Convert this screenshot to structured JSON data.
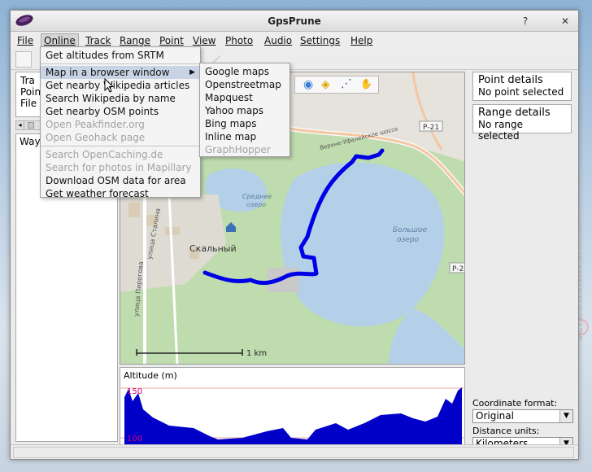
{
  "window": {
    "title": "GpsPrune",
    "buttons": [
      "?",
      "✕"
    ]
  },
  "menubar": {
    "items": [
      "File",
      "Online",
      "Track",
      "Range",
      "Point",
      "View",
      "Photo",
      "Audio",
      "Settings",
      "Help"
    ],
    "active": "Online"
  },
  "online_menu": {
    "items": [
      {
        "label": "Get altitudes from SRTM",
        "enabled": true
      },
      {
        "label": "Map in a browser window",
        "enabled": true,
        "submenu": true
      },
      {
        "label": "Get nearby Wikipedia articles",
        "enabled": true
      },
      {
        "label": "Search Wikipedia by name",
        "enabled": true
      },
      {
        "label": "Get nearby OSM points",
        "enabled": true
      },
      {
        "label": "Open Peakfinder.org",
        "enabled": false
      },
      {
        "label": "Open Geohack page",
        "enabled": false
      },
      {
        "label": "Search OpenCaching.de",
        "enabled": false
      },
      {
        "label": "Search for photos in Mapillary",
        "enabled": false
      },
      {
        "label": "Download OSM data for area",
        "enabled": true
      },
      {
        "label": "Get weather forecast",
        "enabled": true
      }
    ]
  },
  "browser_submenu": {
    "items": [
      {
        "label": "Google maps",
        "enabled": true
      },
      {
        "label": "Openstreetmap",
        "enabled": true
      },
      {
        "label": "Mapquest",
        "enabled": true
      },
      {
        "label": "Yahoo maps",
        "enabled": true
      },
      {
        "label": "Bing maps",
        "enabled": true
      },
      {
        "label": "Inline map",
        "enabled": true
      },
      {
        "label": "GraphHopper",
        "enabled": false
      }
    ]
  },
  "left_panel": {
    "info_lines": [
      "Tra",
      "Poin",
      "File"
    ],
    "waypoints_label": "Way"
  },
  "map": {
    "labels": {
      "lake_medium": "Среднее\nозеро",
      "lake_big": "Большое\nозеро",
      "town": "Скальный",
      "road": "Верхне-Уфалейское шоссе",
      "road_ref": "Р-21",
      "road_ref_2": "Р-2",
      "street_1": "улица Сталина",
      "street_2": "улица Пирогова",
      "scale": "1 km"
    }
  },
  "altitude": {
    "label": "Altitude (m)",
    "max": "150",
    "min": "100"
  },
  "right_panel": {
    "point_details_title": "Point details",
    "point_details_value": "No point selected",
    "range_details_title": "Range details",
    "range_details_value": "No range selected",
    "coord_format_label": "Coordinate format:",
    "coord_format_value": "Original",
    "distance_units_label": "Distance units:",
    "distance_units_value": "Kilometers"
  },
  "watermark": "screenshots.debian.net",
  "colors": {
    "track": "#0000e6",
    "altitude_fill": "#0000c8",
    "water": "#b3d0e8",
    "forest": "#bfdcae"
  }
}
